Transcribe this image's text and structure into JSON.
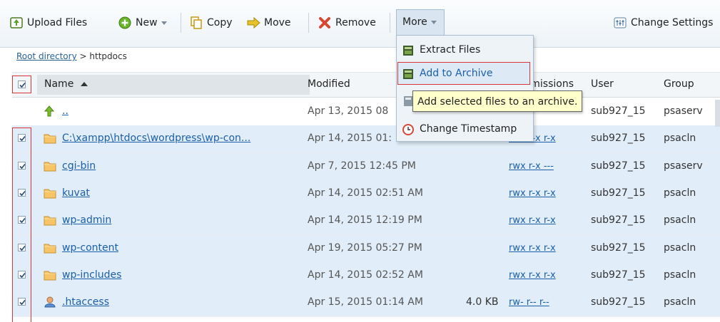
{
  "toolbar": {
    "upload": "Upload Files",
    "new": "New",
    "copy": "Copy",
    "move": "Move",
    "remove": "Remove",
    "more": "More",
    "settings": "Change Settings"
  },
  "breadcrumb": {
    "root": "Root directory",
    "sep": ">",
    "current": "httpdocs"
  },
  "columns": {
    "name": "Name",
    "modified": "Modified",
    "permissions": "Permissions",
    "user": "User",
    "group": "Group"
  },
  "rows": [
    {
      "name": "..",
      "modified": "Apr 13, 2015 08",
      "size": "",
      "perm": "",
      "user": "sub927_15",
      "group": "psaserv",
      "icon": "up-arrow-icon",
      "selected": false
    },
    {
      "name": "C:\\xampp\\htdocs\\wordpress\\wp-con...",
      "modified": "Apr 14, 2015 01:",
      "size": "",
      "perm": "rwx r-x r-x",
      "user": "sub927_15",
      "group": "psacln",
      "icon": "folder-icon",
      "selected": true
    },
    {
      "name": "cgi-bin",
      "modified": "Apr 7, 2015 12:45 PM",
      "size": "",
      "perm": "rwx r-x ---",
      "user": "sub927_15",
      "group": "psaserv",
      "icon": "folder-icon",
      "selected": true
    },
    {
      "name": "kuvat",
      "modified": "Apr 14, 2015 02:51 AM",
      "size": "",
      "perm": "rwx r-x r-x",
      "user": "sub927_15",
      "group": "psacln",
      "icon": "folder-icon",
      "selected": true
    },
    {
      "name": "wp-admin",
      "modified": "Apr 14, 2015 12:19 PM",
      "size": "",
      "perm": "rwx r-x r-x",
      "user": "sub927_15",
      "group": "psacln",
      "icon": "folder-icon",
      "selected": true
    },
    {
      "name": "wp-content",
      "modified": "Apr 19, 2015 05:27 PM",
      "size": "",
      "perm": "rwx r-x r-x",
      "user": "sub927_15",
      "group": "psacln",
      "icon": "folder-icon",
      "selected": true
    },
    {
      "name": "wp-includes",
      "modified": "Apr 14, 2015 02:52 AM",
      "size": "",
      "perm": "rwx r-x r-x",
      "user": "sub927_15",
      "group": "psacln",
      "icon": "folder-icon",
      "selected": true
    },
    {
      "name": ".htaccess",
      "modified": "Apr 15, 2015 01:14 AM",
      "size": "4.0 KB",
      "perm": "rw- r-- r--",
      "user": "sub927_15",
      "group": "psacln",
      "icon": "user-file-icon",
      "selected": true
    }
  ],
  "menu": {
    "extract": "Extract Files",
    "archive": "Add to Archive",
    "timestamp": "Change Timestamp",
    "tooltip": "Add selected files to an archive."
  },
  "colors": {
    "accent": "#1b5fa8",
    "highlight": "#d9343a",
    "selected_row": "#e1edf8"
  }
}
